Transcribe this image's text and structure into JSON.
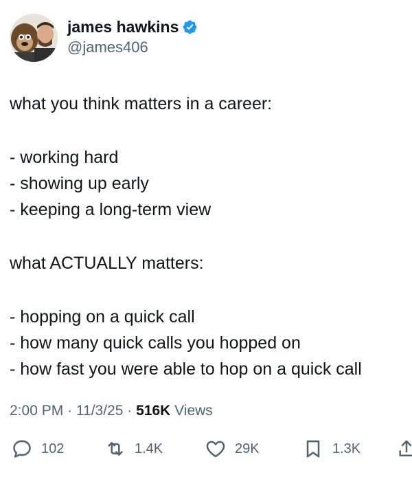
{
  "author": {
    "display_name": "james hawkins",
    "handle": "@james406",
    "verified": true,
    "verified_icon": "verified-badge-icon",
    "verified_color": "#1d9bf0"
  },
  "tweet": {
    "lines": [
      "what you think matters in a career:",
      "",
      "- working hard",
      "- showing up early",
      "- keeping a long-term view",
      "",
      "what ACTUALLY matters:",
      "",
      "- hopping on a quick call",
      "- how many quick calls you hopped on",
      "- how fast you were able to hop on a quick call"
    ]
  },
  "meta": {
    "time": "2:00 PM",
    "separator": "·",
    "date": "11/3/25",
    "views_count": "516K",
    "views_label": "Views"
  },
  "actions": {
    "reply": {
      "icon": "reply-icon",
      "count": "102"
    },
    "retweet": {
      "icon": "retweet-icon",
      "count": "1.4K"
    },
    "like": {
      "icon": "heart-icon",
      "count": "29K"
    },
    "bookmark": {
      "icon": "bookmark-icon",
      "count": "1.3K"
    },
    "share": {
      "icon": "share-icon"
    }
  },
  "colors": {
    "text": "#0f1419",
    "secondary": "#536471",
    "accent": "#1d9bf0"
  }
}
